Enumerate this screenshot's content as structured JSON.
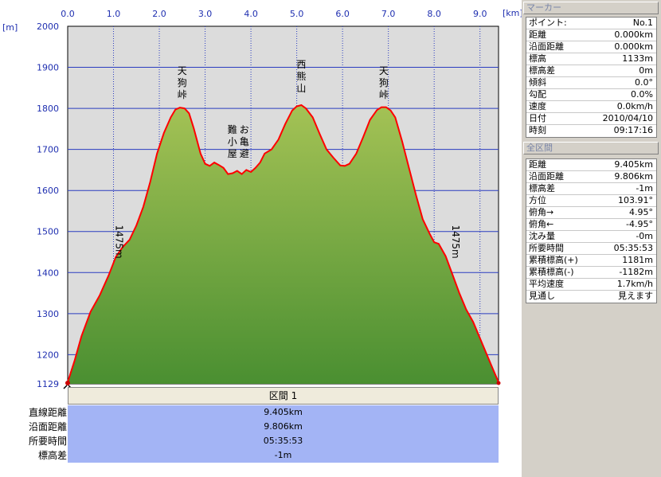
{
  "chart_data": {
    "type": "area",
    "x_unit": "[km]",
    "y_unit": "[m]",
    "xlim": [
      0.0,
      9.405
    ],
    "ylim": [
      1129,
      2000
    ],
    "x_ticks": [
      "0.0",
      "1.0",
      "2.0",
      "3.0",
      "4.0",
      "5.0",
      "6.0",
      "7.0",
      "8.0",
      "9.0"
    ],
    "y_ticks": [
      "2000",
      "1900",
      "1800",
      "1700",
      "1600",
      "1500",
      "1400",
      "1300",
      "1200",
      "1129"
    ],
    "annotations": [
      {
        "text": "天狗峠",
        "x": 2.5,
        "y": 1810
      },
      {
        "text": "西熊山",
        "x": 5.1,
        "y": 1815
      },
      {
        "text": "天狗峠",
        "x": 6.9,
        "y": 1810
      },
      {
        "text": "お亀避難小屋",
        "x": 3.75,
        "y": 1650
      },
      {
        "text": "1475m",
        "x": 1.05,
        "y": 1475
      },
      {
        "text": "1475m",
        "x": 8.4,
        "y": 1475
      }
    ],
    "x": [
      0.0,
      0.15,
      0.3,
      0.5,
      0.7,
      0.9,
      1.05,
      1.2,
      1.35,
      1.5,
      1.65,
      1.8,
      1.95,
      2.1,
      2.25,
      2.35,
      2.45,
      2.55,
      2.65,
      2.75,
      2.9,
      3.0,
      3.1,
      3.2,
      3.3,
      3.4,
      3.5,
      3.6,
      3.7,
      3.8,
      3.9,
      4.0,
      4.1,
      4.2,
      4.3,
      4.45,
      4.6,
      4.75,
      4.9,
      5.0,
      5.1,
      5.2,
      5.35,
      5.5,
      5.65,
      5.8,
      5.95,
      6.05,
      6.15,
      6.3,
      6.45,
      6.6,
      6.75,
      6.85,
      6.95,
      7.05,
      7.15,
      7.3,
      7.45,
      7.6,
      7.75,
      7.9,
      8.0,
      8.1,
      8.25,
      8.4,
      8.55,
      8.7,
      8.85,
      9.0,
      9.15,
      9.3,
      9.405
    ],
    "y": [
      1133,
      1185,
      1245,
      1305,
      1345,
      1395,
      1438,
      1462,
      1480,
      1515,
      1560,
      1620,
      1690,
      1740,
      1778,
      1797,
      1802,
      1800,
      1788,
      1752,
      1690,
      1665,
      1660,
      1668,
      1662,
      1655,
      1640,
      1642,
      1648,
      1640,
      1650,
      1645,
      1655,
      1668,
      1690,
      1700,
      1724,
      1762,
      1795,
      1805,
      1808,
      1800,
      1778,
      1738,
      1700,
      1680,
      1661,
      1660,
      1665,
      1690,
      1730,
      1772,
      1796,
      1803,
      1803,
      1795,
      1778,
      1720,
      1655,
      1590,
      1530,
      1495,
      1474,
      1470,
      1440,
      1395,
      1350,
      1310,
      1280,
      1240,
      1200,
      1160,
      1133
    ]
  },
  "summary": {
    "section_label": "区間 1",
    "rows": [
      {
        "label": "直線距離",
        "value": "9.405km"
      },
      {
        "label": "沿面距離",
        "value": "9.806km"
      },
      {
        "label": "所要時間",
        "value": "05:35:53"
      },
      {
        "label": "標高差",
        "value": "-1m"
      }
    ]
  },
  "marker_panel": {
    "title": "マーカー",
    "rows": [
      {
        "label": "ポイント:",
        "value": "No.1"
      },
      {
        "label": "距離",
        "value": "0.000km"
      },
      {
        "label": "沿面距離",
        "value": "0.000km"
      },
      {
        "label": "標高",
        "value": "1133m"
      },
      {
        "label": "標高差",
        "value": "0m"
      },
      {
        "label": "傾斜",
        "value": "0.0°"
      },
      {
        "label": "勾配",
        "value": "0.0%"
      },
      {
        "label": "速度",
        "value": "0.0km/h"
      },
      {
        "label": "日付",
        "value": "2010/04/10"
      },
      {
        "label": "時刻",
        "value": "09:17:16"
      }
    ]
  },
  "section_panel": {
    "title": "全区間",
    "rows": [
      {
        "label": "距離",
        "value": "9.405km"
      },
      {
        "label": "沿面距離",
        "value": "9.806km"
      },
      {
        "label": "標高差",
        "value": "-1m"
      },
      {
        "label": "方位",
        "value": "103.91°"
      },
      {
        "label": "俯角→",
        "value": "4.95°"
      },
      {
        "label": "俯角←",
        "value": "-4.95°"
      },
      {
        "label": "沈み量",
        "value": "-0m"
      },
      {
        "label": "所要時間",
        "value": "05:35:53"
      },
      {
        "label": "累積標高(+)",
        "value": "1181m"
      },
      {
        "label": "累積標高(-)",
        "value": "-1182m"
      },
      {
        "label": "平均速度",
        "value": "1.7km/h"
      },
      {
        "label": "見通し",
        "value": "見えます"
      }
    ]
  },
  "colors": {
    "plot_bg": "#dcdcdc",
    "area_top": "#9fbe50",
    "area_bottom": "#4f9233",
    "profile_line": "#ff0000",
    "grid": "#1f2fb0"
  }
}
